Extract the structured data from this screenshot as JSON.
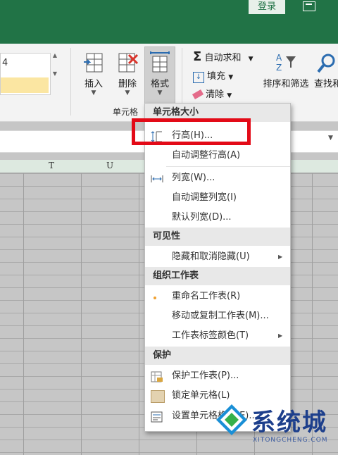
{
  "titlebar": {
    "login": "登录",
    "restore_icon": "restore-icon"
  },
  "ribbon": {
    "style_value": "4",
    "cells_group": {
      "label": "单元格",
      "insert": "插入",
      "delete": "删除",
      "format": "格式"
    },
    "editing": {
      "autosum": "自动求和",
      "fill": "填充",
      "clear": "清除",
      "sort_filter": "排序和筛选",
      "find_select": "查找和"
    }
  },
  "columns": [
    "T",
    "U"
  ],
  "menu": {
    "sections": [
      {
        "title": "单元格大小",
        "items": [
          {
            "label": "行高(H)...",
            "icon": "row-height-icon"
          },
          {
            "label": "自动调整行高(A)"
          },
          {
            "label": "列宽(W)...",
            "icon": "column-width-icon"
          },
          {
            "label": "自动调整列宽(I)"
          },
          {
            "label": "默认列宽(D)..."
          }
        ]
      },
      {
        "title": "可见性",
        "items": [
          {
            "label": "隐藏和取消隐藏(U)",
            "submenu": true
          }
        ]
      },
      {
        "title": "组织工作表",
        "items": [
          {
            "label": "重命名工作表(R)",
            "icon": "rename-sheet-icon"
          },
          {
            "label": "移动或复制工作表(M)..."
          },
          {
            "label": "工作表标签颜色(T)",
            "submenu": true
          }
        ]
      },
      {
        "title": "保护",
        "items": [
          {
            "label": "保护工作表(P)...",
            "icon": "protect-sheet-icon"
          },
          {
            "label": "锁定单元格(L)",
            "icon": "lock-cell-icon"
          },
          {
            "label": "设置单元格格式(E)...",
            "icon": "format-cells-icon"
          }
        ]
      }
    ]
  },
  "watermark": {
    "text": "系统城",
    "domain": "XITONGCHENG.COM"
  },
  "colors": {
    "excel_green": "#217346",
    "highlight_red": "#e30a17"
  }
}
